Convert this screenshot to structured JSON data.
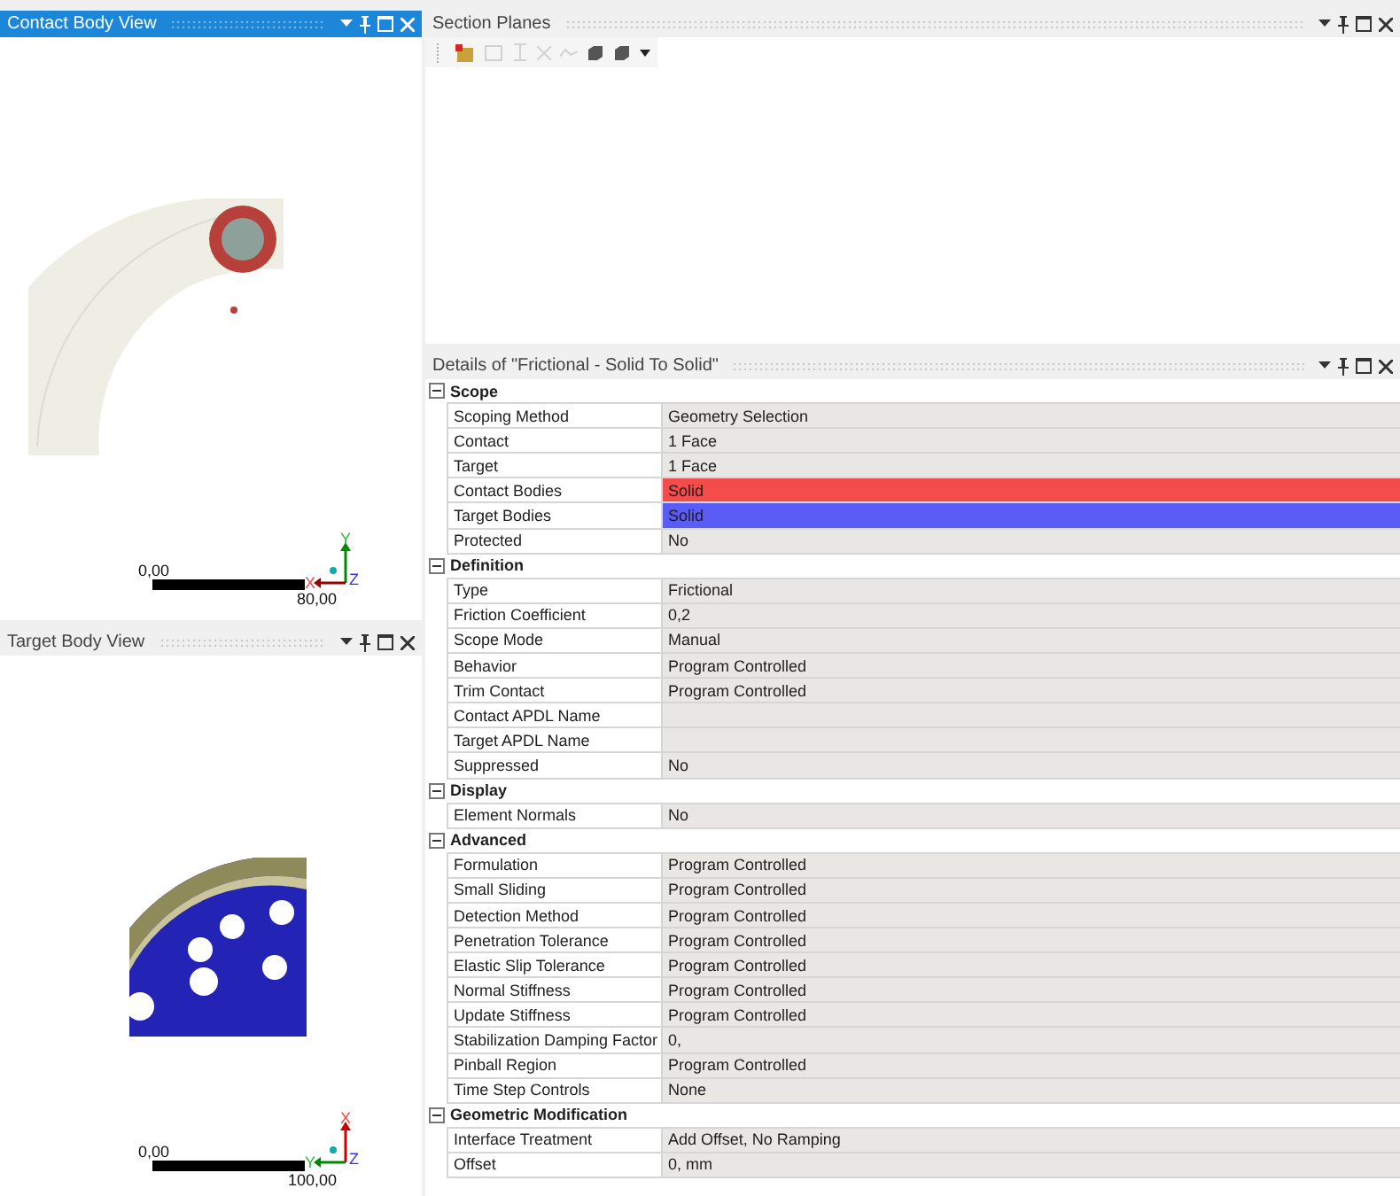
{
  "views": [
    {
      "title": "Contact Body View",
      "active": true,
      "kind": "contact",
      "scale": {
        "start": "0,00",
        "end": "80,00"
      },
      "axes": {
        "up": "Y",
        "left": "X",
        "depth": "Z"
      }
    },
    {
      "title": "Target Body View",
      "active": false,
      "kind": "target",
      "scale": {
        "start": "0,00",
        "end": "100,00"
      },
      "axes": {
        "up": "X",
        "left": "Y",
        "depth": "Z"
      }
    }
  ],
  "section_planes": {
    "title": "Section Planes",
    "tools": [
      {
        "kind": "new",
        "disabled": false
      },
      {
        "kind": "edit",
        "disabled": true
      },
      {
        "kind": "flip",
        "disabled": true
      },
      {
        "kind": "delete",
        "disabled": true
      },
      {
        "kind": "cap",
        "disabled": true
      },
      {
        "kind": "solid",
        "disabled": false
      },
      {
        "kind": "solid",
        "disabled": false
      },
      {
        "kind": "menu",
        "disabled": false
      }
    ]
  },
  "details": {
    "title": "Details of \"Frictional - Solid To Solid\"",
    "sections": [
      {
        "title": "Scope",
        "expanded": true,
        "rows": [
          {
            "label": "Scoping Method",
            "value": "Geometry Selection"
          },
          {
            "label": "Contact",
            "value": "1 Face"
          },
          {
            "label": "Target",
            "value": "1 Face"
          },
          {
            "label": "Contact Bodies",
            "value": "Solid",
            "color": "#f44b4b"
          },
          {
            "label": "Target Bodies",
            "value": "Solid",
            "color": "#5b5bf5"
          },
          {
            "label": "Protected",
            "value": "No"
          }
        ]
      },
      {
        "title": "Definition",
        "expanded": true,
        "rows": [
          {
            "label": "Type",
            "value": "Frictional"
          },
          {
            "label": "Friction Coefficient",
            "value": "0,2"
          },
          {
            "label": "Scope Mode",
            "value": "Manual"
          },
          {
            "label": "Behavior",
            "value": "Program Controlled"
          },
          {
            "label": "Trim Contact",
            "value": "Program Controlled"
          },
          {
            "label": "Contact APDL Name"
          },
          {
            "label": "Target APDL Name"
          },
          {
            "label": "Suppressed",
            "value": "No"
          }
        ]
      },
      {
        "title": "Display",
        "expanded": true,
        "rows": [
          {
            "label": "Element Normals",
            "value": "No"
          }
        ]
      },
      {
        "title": "Advanced",
        "expanded": true,
        "rows": [
          {
            "label": "Formulation",
            "value": "Program Controlled"
          },
          {
            "label": "Small Sliding",
            "value": "Program Controlled"
          },
          {
            "label": "Detection Method",
            "value": "Program Controlled"
          },
          {
            "label": "Penetration Tolerance",
            "value": "Program Controlled"
          },
          {
            "label": "Elastic Slip Tolerance",
            "value": "Program Controlled"
          },
          {
            "label": "Normal Stiffness",
            "value": "Program Controlled"
          },
          {
            "label": "Update Stiffness",
            "value": "Program Controlled"
          },
          {
            "label": "Stabilization Damping Factor",
            "value": "0,"
          },
          {
            "label": "Pinball Region",
            "value": "Program Controlled"
          },
          {
            "label": "Time Step Controls",
            "value": "None"
          }
        ]
      },
      {
        "title": "Geometric Modification",
        "expanded": true,
        "rows": [
          {
            "label": "Interface Treatment",
            "value": "Add Offset, No Ramping"
          },
          {
            "label": "Offset",
            "value": "0, mm"
          }
        ]
      }
    ]
  }
}
